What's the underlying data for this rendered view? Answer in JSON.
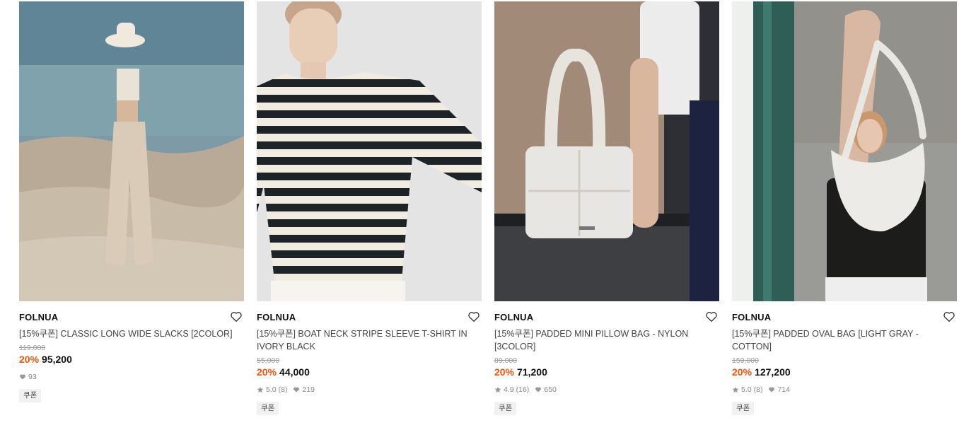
{
  "products": [
    {
      "brand": "FOLNUA",
      "name": "[15%쿠폰] CLASSIC LONG WIDE SLACKS [2COLOR]",
      "original_price": "119,000",
      "discount": "20%",
      "price": "95,200",
      "rating": "",
      "reviews": "",
      "likes": "93",
      "tag": "쿠폰"
    },
    {
      "brand": "FOLNUA",
      "name": "[15%쿠폰] BOAT NECK STRIPE SLEEVE T-SHIRT IN IVORY BLACK",
      "original_price": "55,000",
      "discount": "20%",
      "price": "44,000",
      "rating": "5.0",
      "reviews": "(8)",
      "likes": "219",
      "tag": "쿠폰"
    },
    {
      "brand": "FOLNUA",
      "name": "[15%쿠폰] PADDED MINI PILLOW BAG - NYLON [3COLOR]",
      "original_price": "89,000",
      "discount": "20%",
      "price": "71,200",
      "rating": "4.9",
      "reviews": "(16)",
      "likes": "650",
      "tag": "쿠폰"
    },
    {
      "brand": "FOLNUA",
      "name": "[15%쿠폰] PADDED OVAL BAG [LIGHT GRAY - COTTON]",
      "original_price": "159,000",
      "discount": "20%",
      "price": "127,200",
      "rating": "5.0",
      "reviews": "(8)",
      "likes": "714",
      "tag": "쿠폰"
    }
  ],
  "icons": {
    "wishlist": "heart-outline-icon",
    "rating": "star-icon",
    "likes": "heart-filled-icon"
  },
  "colors": {
    "discount": "#e8560f",
    "brand_text": "#111111",
    "muted_text": "#888888",
    "tag_bg": "#f1f1f1"
  }
}
